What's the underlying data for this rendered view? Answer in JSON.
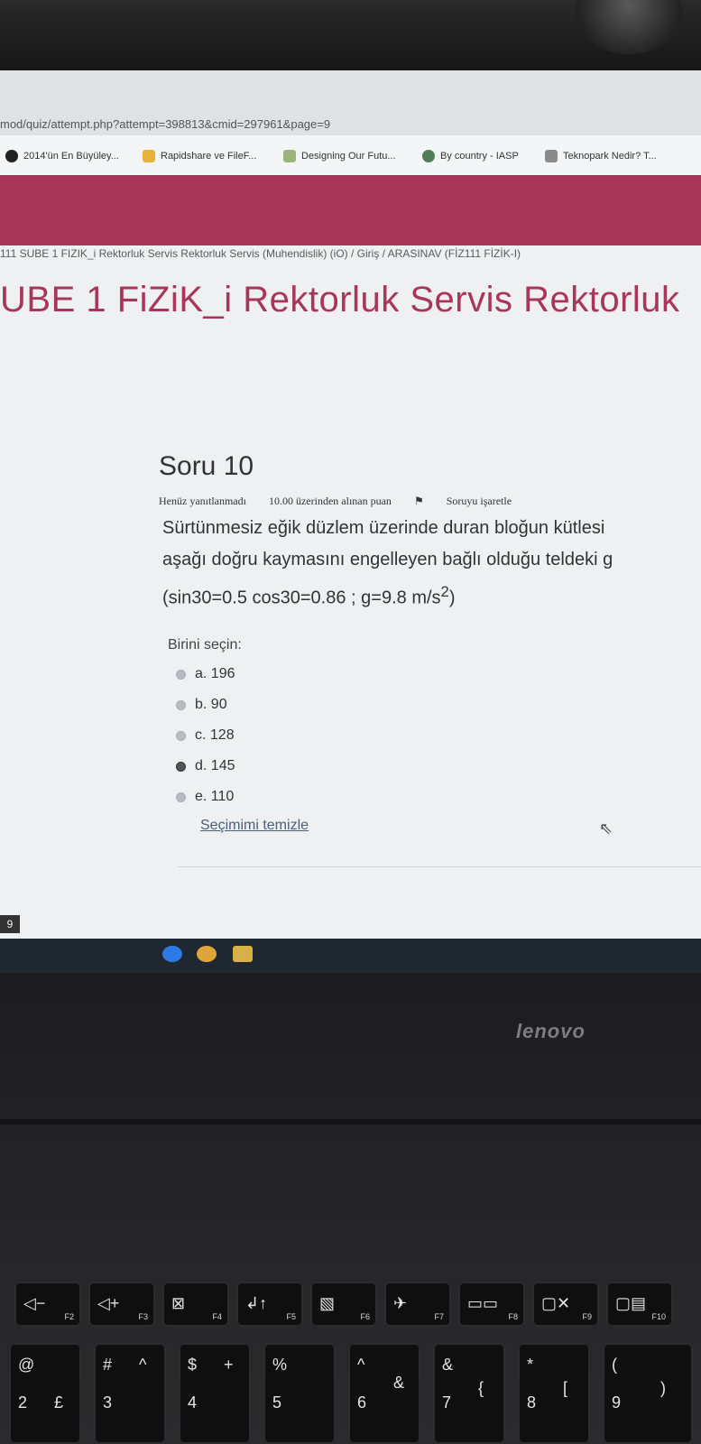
{
  "browser": {
    "url": "mod/quiz/attempt.php?attempt=398813&cmid=297961&page=9",
    "bookmarks": [
      {
        "label": "2014'ün En Büyüley...",
        "icon": "bookmark-site-icon"
      },
      {
        "label": "Rapidshare ve FileF...",
        "icon": "bookmark-download-icon"
      },
      {
        "label": "Designing Our Futu...",
        "icon": "bookmark-image-icon"
      },
      {
        "label": "By country - IASP",
        "icon": "bookmark-globe-icon"
      },
      {
        "label": "Teknopark Nedir? T...",
        "icon": "bookmark-site-icon"
      }
    ]
  },
  "page": {
    "breadcrumb": "111 SUBE 1 FIZIK_i Rektorluk Servis Rektorluk Servis (Muhendislik) (iO)  /  Giriş  /  ARASINAV (FİZ111 FİZİK-I)",
    "course_title": "UBE 1 FiZiK_i Rektorluk Servis Rektorluk",
    "accent_color": "#a8365a"
  },
  "question": {
    "number": "Soru 10",
    "status": "Henüz yanıtlanmadı",
    "mark": "10.00 üzerinden alınan puan",
    "flag": "Soruyu işaretle",
    "text_line1": "Sürtünmesiz eğik düzlem üzerinde duran bloğun kütlesi",
    "text_line2": "aşağı doğru kaymasını engelleyen bağlı olduğu teldeki g",
    "text_line3_a": "(sin30=0.5 cos30=0.86 ;  g=9.8 m/s",
    "text_line3_sup": "2",
    "text_line3_b": ")",
    "prompt": "Birini seçin:",
    "options": [
      {
        "label": "a. 196",
        "selected": false
      },
      {
        "label": "b. 90",
        "selected": false
      },
      {
        "label": "c. 128",
        "selected": false
      },
      {
        "label": "d. 145",
        "selected": true
      },
      {
        "label": "e. 110",
        "selected": false
      }
    ],
    "clear_label": "Seçimimi temizle"
  },
  "taskbar_badge": "9",
  "laptop": {
    "brand": "lenovo",
    "fkeys": [
      {
        "symbol": "◁−",
        "label": "F2"
      },
      {
        "symbol": "◁+",
        "label": "F3"
      },
      {
        "symbol": "⊠",
        "label": "F4"
      },
      {
        "symbol": "↲↑",
        "label": "F5"
      },
      {
        "symbol": "▧",
        "label": "F6"
      },
      {
        "symbol": "✈",
        "label": "F7"
      },
      {
        "symbol": "▭▭",
        "label": "F8"
      },
      {
        "symbol": "▢✕",
        "label": "F9"
      },
      {
        "symbol": "▢▤",
        "label": "F10"
      }
    ],
    "numkeys": [
      {
        "top": "@",
        "bottom": "2",
        "alt": "£"
      },
      {
        "top": "#",
        "bottom": "3",
        "alt": "^"
      },
      {
        "top": "$",
        "bottom": "4",
        "alt": "+"
      },
      {
        "top": "%",
        "bottom": "5",
        "alt": ""
      },
      {
        "top": "^",
        "bottom": "6",
        "alt": "&"
      },
      {
        "top": "&",
        "bottom": "7",
        "alt": "{"
      },
      {
        "top": "*",
        "bottom": "8",
        "alt": "["
      },
      {
        "top": "(",
        "bottom": "9",
        "alt": ")"
      }
    ]
  }
}
